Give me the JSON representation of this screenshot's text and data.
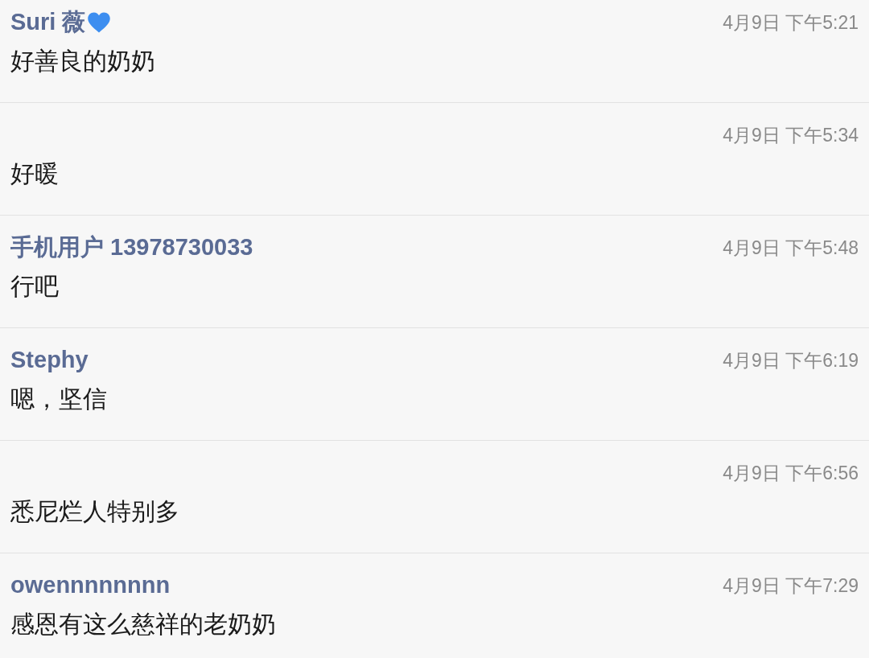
{
  "comments": [
    {
      "author": "Suri 薇",
      "heart": true,
      "time": "4月9日 下午5:21",
      "text": "好善良的奶奶"
    },
    {
      "time": "4月9日 下午5:34",
      "text": "好暖"
    },
    {
      "author": "手机用户 13978730033",
      "time": "4月9日 下午5:48",
      "text": "行吧"
    },
    {
      "author": "Stephy",
      "time": "4月9日 下午6:19",
      "text": "嗯，坚信"
    },
    {
      "time": "4月9日 下午6:56",
      "text": "悉尼烂人特别多"
    },
    {
      "author": "owennnnnnnn",
      "time": "4月9日 下午7:29",
      "text": "感恩有这么慈祥的老奶奶"
    }
  ]
}
